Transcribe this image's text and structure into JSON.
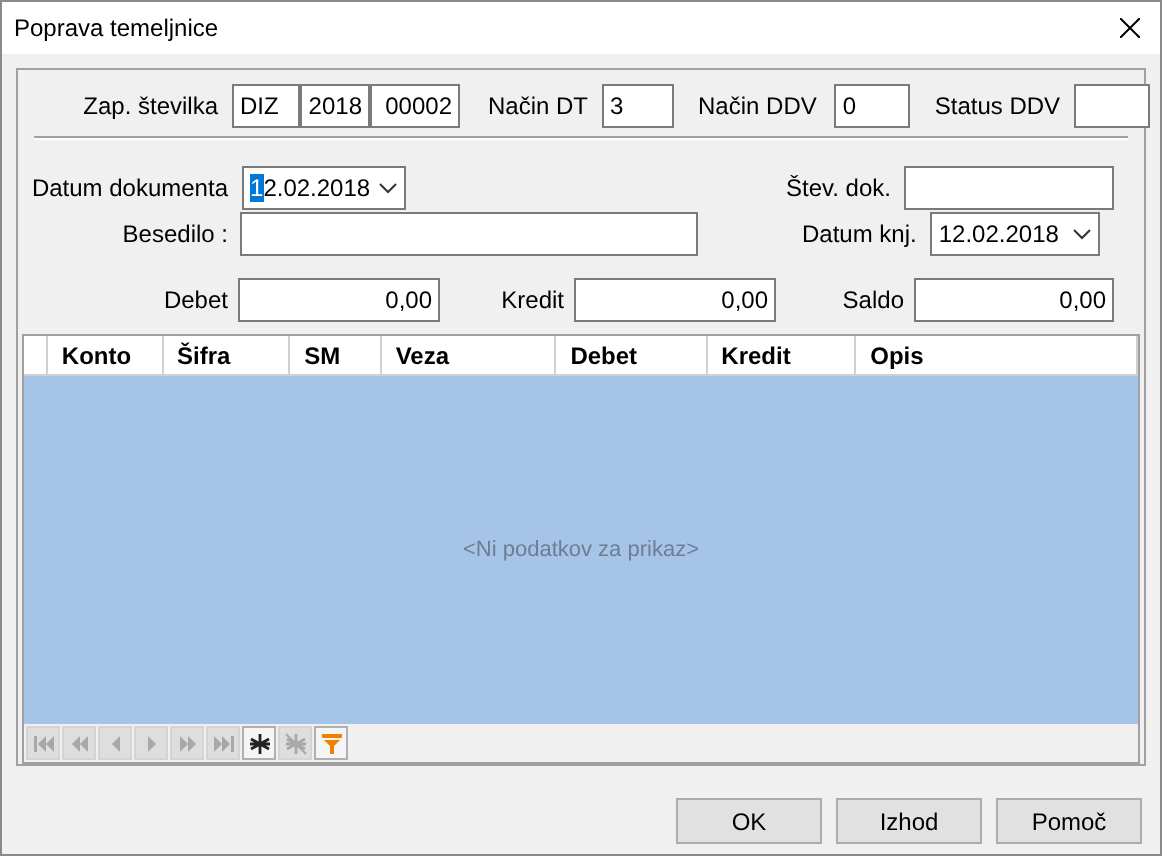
{
  "window": {
    "title": "Poprava temeljnice"
  },
  "header": {
    "zap_label": "Zap. številka",
    "zap_parts": [
      "DIZ",
      "2018",
      "00002"
    ],
    "nacin_dt_label": "Način DT",
    "nacin_dt": "3",
    "nacin_ddv_label": "Način DDV",
    "nacin_ddv": "0",
    "status_ddv_label": "Status DDV"
  },
  "document": {
    "datum_label": "Datum dokumenta",
    "datum": "12.02.2018",
    "stev_label": "Štev. dok.",
    "besedilo_label": "Besedilo :",
    "datum_knj_label": "Datum knj.",
    "datum_knj": "12.02.2018"
  },
  "totals": [
    {
      "label": "Debet",
      "value": "0,00"
    },
    {
      "label": "Kredit",
      "value": "0,00"
    },
    {
      "label": "Saldo",
      "value": "0,00"
    }
  ],
  "table": {
    "columns": [
      "Konto",
      "Šifra",
      "SM",
      "Veza",
      "Debet",
      "Kredit",
      "Opis"
    ],
    "empty_text": "<Ni podatkov za prikaz>"
  },
  "navigator": [
    {
      "kind": "first",
      "disabled": true
    },
    {
      "kind": "prev_page",
      "disabled": true
    },
    {
      "kind": "prev",
      "disabled": true
    },
    {
      "kind": "next",
      "disabled": true
    },
    {
      "kind": "next_page",
      "disabled": true
    },
    {
      "kind": "last",
      "disabled": true
    },
    {
      "kind": "add",
      "disabled": false
    },
    {
      "kind": "delete",
      "disabled": true
    },
    {
      "kind": "filter",
      "disabled": false
    }
  ],
  "buttons": [
    "OK",
    "Izhod",
    "Pomoč"
  ]
}
